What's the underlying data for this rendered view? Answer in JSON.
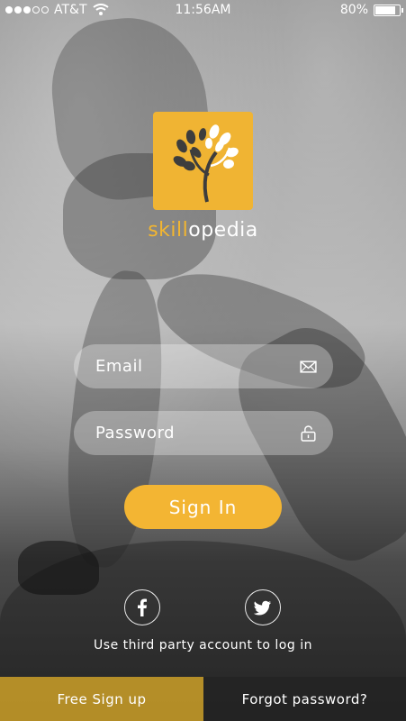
{
  "status_bar": {
    "carrier": "AT&T",
    "time": "11:56AM",
    "battery": "80%",
    "battery_level": 0.8,
    "signal_bars_filled": 3,
    "signal_bars_total": 5
  },
  "brand": {
    "name_part1": "skill",
    "name_part2": "opedia",
    "accent_color": "#f3b630"
  },
  "login": {
    "email_placeholder": "Email",
    "password_placeholder": "Password",
    "signin_label": "Sign In"
  },
  "social": {
    "facebook_icon": "facebook-icon",
    "twitter_icon": "twitter-icon",
    "caption": "Use third party account to log in"
  },
  "footer": {
    "signup_label": "Free Sign up",
    "forgot_label": "Forgot password?"
  }
}
